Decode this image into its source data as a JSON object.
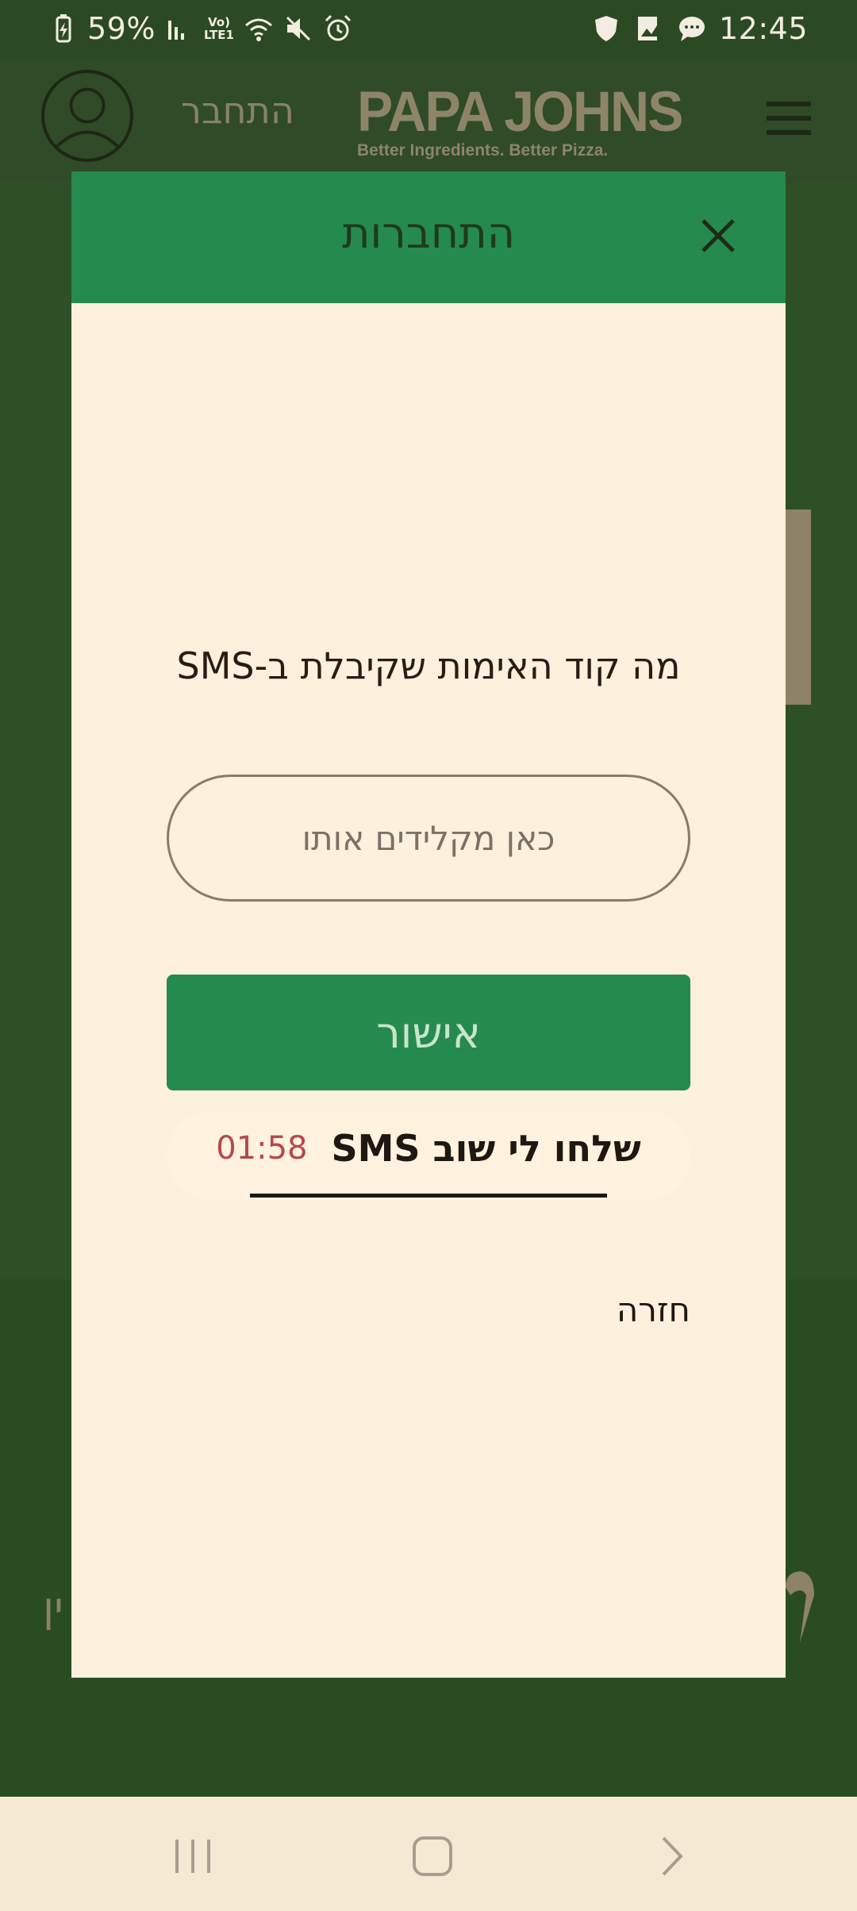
{
  "status_bar": {
    "battery": "59%",
    "network_label": "Vo) LTE1",
    "time": "12:45"
  },
  "header": {
    "login_label": "התחבר",
    "brand_name": "PAPA JOHNS",
    "brand_tagline": "Better Ingredients. Better Pizza."
  },
  "background": {
    "left_text": "ין"
  },
  "modal": {
    "title": "התחברות",
    "question": "מה קוד האימות שקיבלת ב-SMS",
    "code_input": {
      "placeholder": "כאן מקלידים אותו",
      "value": ""
    },
    "confirm_label": "אישור",
    "resend_label": "שלחו לי שוב SMS",
    "resend_timer": "01:58",
    "back_label": "חזרה"
  },
  "colors": {
    "header_green": "#258a4e",
    "modal_bg": "#fdf0dc",
    "timer_red": "#b4484b",
    "dim_overlay": "#2e5027"
  }
}
